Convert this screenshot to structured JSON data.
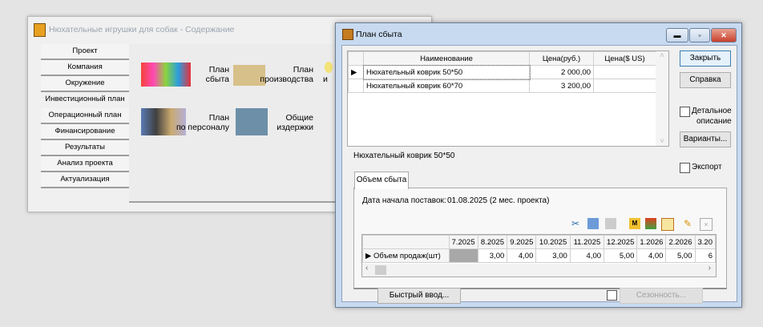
{
  "back_window": {
    "title": "Нюхательные игрушки для собак - Содержание",
    "nav": [
      "Проект",
      "Компания",
      "Окружение",
      "Инвестиционный план",
      "Операционный план",
      "Финансирование",
      "Результаты",
      "Анализ проекта",
      "Актуализация"
    ],
    "tiles": [
      {
        "line1": "План",
        "line2": "сбыта"
      },
      {
        "line1": "План",
        "line2": "производства"
      },
      {
        "line1": "План",
        "line2": "по персоналу"
      },
      {
        "line1": "Общие",
        "line2": "издержки"
      },
      {
        "line1": "",
        "line2": "и"
      }
    ]
  },
  "front_window": {
    "title": "План сбыта",
    "products_table": {
      "headers": [
        "Наименование",
        "Цена(руб.)",
        "Цена($ US)"
      ],
      "rows": [
        [
          "Нюхательный коврик 50*50",
          "2 000,00",
          ""
        ],
        [
          "Нюхательный коврик 60*70",
          "3 200,00",
          ""
        ]
      ]
    },
    "buttons": {
      "close": "Закрыть",
      "help": "Справка",
      "variants": "Варианты...",
      "quick_input": "Быстрый ввод...",
      "seasonality": "Сезонность..."
    },
    "checkboxes": {
      "detailed_line1": "Детальное",
      "detailed_line2": "описание",
      "export": "Экспорт"
    },
    "group_label": "Нюхательный коврик 50*50",
    "tab": "Объем сбыта",
    "start_date_label": "Дата начала поставок:",
    "start_date_value": "01.08.2025 (2 мес. проекта)",
    "volume_table": {
      "months": [
        "7.2025",
        "8.2025",
        "9.2025",
        "10.2025",
        "11.2025",
        "12.2025",
        "1.2026",
        "2.2026",
        "3.20"
      ],
      "row_label": "Объем продаж(шт)",
      "values": [
        "",
        "3,00",
        "4,00",
        "3,00",
        "4,00",
        "5,00",
        "4,00",
        "5,00",
        "6"
      ]
    }
  }
}
